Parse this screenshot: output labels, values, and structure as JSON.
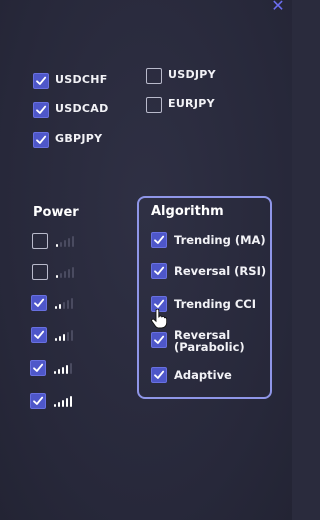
{
  "close_glyph": "✕",
  "pairs": [
    {
      "label": "USDCHF",
      "checked": true
    },
    {
      "label": "USDJPY",
      "checked": false
    },
    {
      "label": "USDCAD",
      "checked": true
    },
    {
      "label": "EURJPY",
      "checked": false
    },
    {
      "label": "GBPJPY",
      "checked": true
    }
  ],
  "power": {
    "title": "Power",
    "levels": [
      {
        "checked": false,
        "filled": 1
      },
      {
        "checked": false,
        "filled": 1
      },
      {
        "checked": true,
        "filled": 2
      },
      {
        "checked": true,
        "filled": 3
      },
      {
        "checked": true,
        "filled": 4
      },
      {
        "checked": true,
        "filled": 5
      }
    ]
  },
  "algorithm": {
    "title": "Algorithm",
    "items": [
      {
        "label": "Trending (MA)",
        "checked": true
      },
      {
        "label": "Reversal (RSI)",
        "checked": true
      },
      {
        "label": "Trending CCI",
        "checked": true
      },
      {
        "label": "Reversal\n(Parabolic)",
        "checked": true
      },
      {
        "label": "Adaptive",
        "checked": true
      }
    ]
  },
  "colors": {
    "accent": "#4e57c9",
    "box_border": "#8f96e8",
    "close": "#6c6ef0"
  }
}
